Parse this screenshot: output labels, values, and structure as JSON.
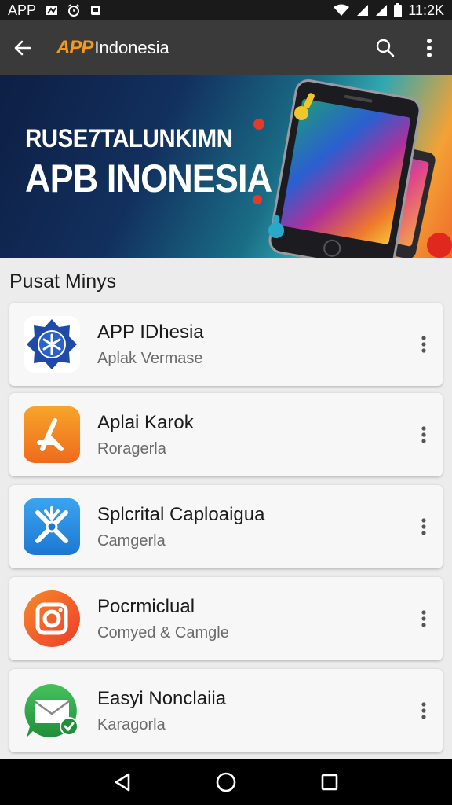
{
  "status_bar": {
    "carrier": "APP",
    "time": "11:2K",
    "icons": [
      "image-icon",
      "alarm-icon",
      "notification-icon",
      "wifi-icon",
      "signal-icon",
      "signal-icon",
      "battery-icon"
    ]
  },
  "app_bar": {
    "logo_mark": "APP",
    "logo_name": "Indonesia",
    "icons": [
      "back-arrow-icon",
      "search-icon",
      "more-vert-icon"
    ]
  },
  "banner": {
    "line1": "RUSE7TALUNKIMN",
    "line2": "APB INONESIA"
  },
  "section": {
    "title": "Pusat Minys"
  },
  "apps": [
    {
      "title": "APP IDhesia",
      "subtitle": "Aplak Vermase",
      "icon": "snowflake-badge-icon",
      "color": "#1f4aa8"
    },
    {
      "title": "Aplai Karok",
      "subtitle": "Roragerla",
      "icon": "app-store-a-icon",
      "color": "#f28a1e"
    },
    {
      "title": "Splcrital Caploaigua",
      "subtitle": "Camgerla",
      "icon": "tools-icon",
      "color": "#2a8fe0"
    },
    {
      "title": "Pocrmiclual",
      "subtitle": "Comyed & Camgle",
      "icon": "camera-icon",
      "color": "#f25a2a"
    },
    {
      "title": "Easyi Nonclaiia",
      "subtitle": "Karagorla",
      "icon": "mail-check-icon",
      "color": "#2fa84a"
    }
  ],
  "nav_bar": {
    "icons": [
      "back-triangle-icon",
      "home-circle-icon",
      "recents-square-icon"
    ]
  }
}
